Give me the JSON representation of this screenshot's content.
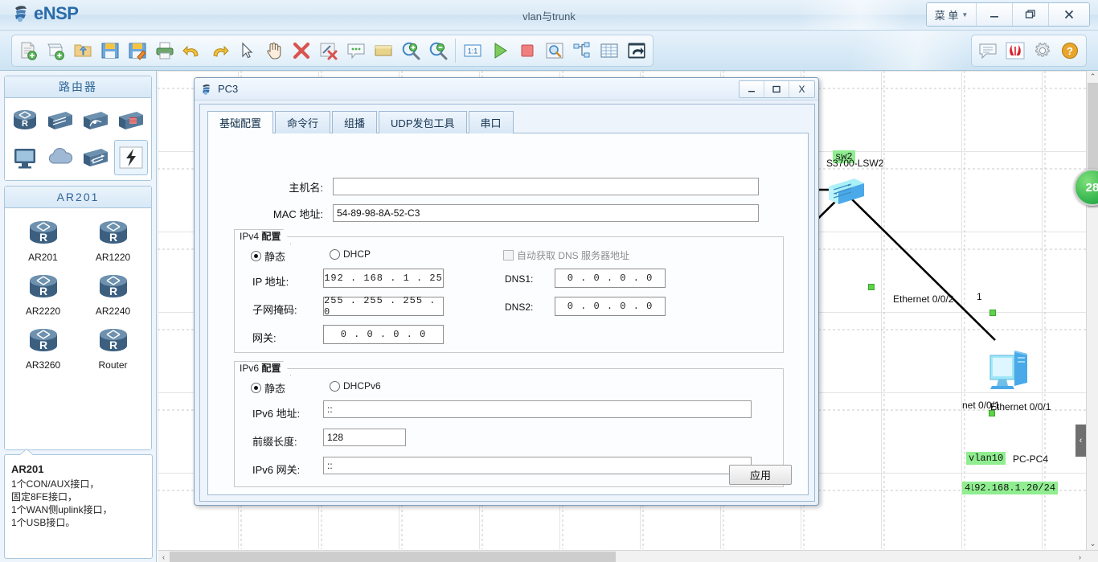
{
  "titlebar": {
    "app_name": "eNSP",
    "project_title": "vlan与trunk",
    "menu_label": "菜 单",
    "minimize": "—",
    "restore": "❐",
    "close": "✕"
  },
  "toolbar": {
    "buttons": [
      {
        "name": "new-topology-icon",
        "tip": "新建"
      },
      {
        "name": "new-device-icon",
        "tip": "新建设备"
      },
      {
        "name": "open-folder-icon",
        "tip": "打开"
      },
      {
        "name": "save-icon",
        "tip": "保存"
      },
      {
        "name": "save-as-icon",
        "tip": "另存为"
      },
      {
        "name": "print-icon",
        "tip": "打印"
      },
      {
        "name": "undo-icon",
        "tip": "撤销"
      },
      {
        "name": "redo-icon",
        "tip": "重做"
      },
      {
        "name": "select-pointer-icon",
        "tip": "选择"
      },
      {
        "name": "pan-hand-icon",
        "tip": "移动"
      },
      {
        "name": "delete-icon",
        "tip": "删除"
      },
      {
        "name": "remove-link-icon",
        "tip": "删除连线"
      },
      {
        "name": "comment-icon",
        "tip": "注释"
      },
      {
        "name": "rectangle-icon",
        "tip": "矩形"
      },
      {
        "name": "zoom-in-icon",
        "tip": "放大"
      },
      {
        "name": "zoom-out-icon",
        "tip": "缩小"
      }
    ],
    "buttons2": [
      {
        "name": "zoom-reset-1to1-icon",
        "tip": "1:1"
      },
      {
        "name": "start-device-icon",
        "tip": "开启设备"
      },
      {
        "name": "stop-device-icon",
        "tip": "停止设备"
      },
      {
        "name": "capture-packet-icon",
        "tip": "数据抓包"
      },
      {
        "name": "topology-tree-icon",
        "tip": "拓扑树"
      },
      {
        "name": "grid-icon",
        "tip": "网格"
      },
      {
        "name": "restore-window-icon",
        "tip": "还原窗口"
      }
    ],
    "right_buttons": [
      {
        "name": "feedback-icon",
        "tip": "反馈"
      },
      {
        "name": "huawei-logo-icon",
        "tip": "华为"
      },
      {
        "name": "settings-gear-icon",
        "tip": "设置"
      },
      {
        "name": "help-icon",
        "tip": "帮助"
      }
    ]
  },
  "sidebar": {
    "category_header": "路由器",
    "device_types": [
      {
        "name": "router-type-icon",
        "selected": false
      },
      {
        "name": "switch-type-icon",
        "selected": false
      },
      {
        "name": "wlan-type-icon",
        "selected": false
      },
      {
        "name": "firewall-type-icon",
        "selected": false
      },
      {
        "name": "endpoint-type-icon",
        "selected": false
      },
      {
        "name": "cloud-type-icon",
        "selected": false
      },
      {
        "name": "other-device-type-icon",
        "selected": false
      },
      {
        "name": "connection-type-icon",
        "selected": true
      }
    ],
    "model_header": "AR201",
    "models": [
      {
        "label": "AR201"
      },
      {
        "label": "AR1220"
      },
      {
        "label": "AR2220"
      },
      {
        "label": "AR2240"
      },
      {
        "label": "AR3260"
      },
      {
        "label": "Router"
      }
    ],
    "info": {
      "title": "AR201",
      "body": "1个CON/AUX接口，\n固定8FE接口，\n1个WAN侧uplink接口，\n1个USB接口。"
    }
  },
  "canvas": {
    "nodes": [
      {
        "name": "switch-sw2",
        "label": "S3700-LSW2",
        "tag": "sw2"
      },
      {
        "name": "pc-pc4",
        "label": "PC-PC4",
        "tag": "vlan10",
        "ip_tag": "192.168.1.20/24"
      }
    ],
    "interface_labels": [
      "Ethernet 0/0/2",
      "Ethernet 0/0/1",
      "net 0/0/1",
      "1",
      "4"
    ],
    "badge_count": "28",
    "collapse_arrow": "‹",
    "scroll_up": "⌃",
    "scroll_down": "⌄",
    "scroll_left": "‹",
    "scroll_right": "›"
  },
  "pc3_dialog": {
    "title": "PC3",
    "window_buttons": {
      "minimize": "—",
      "maximize": "❐",
      "close": "X"
    },
    "tabs": [
      {
        "label": "基础配置",
        "active": true
      },
      {
        "label": "命令行",
        "active": false
      },
      {
        "label": "组播",
        "active": false
      },
      {
        "label": "UDP发包工具",
        "active": false
      },
      {
        "label": "串口",
        "active": false
      }
    ],
    "hostname": {
      "label": "主机名:",
      "value": "",
      "placeholder": ""
    },
    "mac": {
      "label": "MAC 地址:",
      "value": "54-89-98-8A-52-C3"
    },
    "ipv4": {
      "group_title_prefix": "IPv4 ",
      "group_title_bold": "配置",
      "static_label": "静态",
      "static_selected": true,
      "dhcp_label": "DHCP",
      "dhcp_selected": false,
      "auto_dns_label": "自动获取 DNS 服务器地址",
      "auto_dns_checked": false,
      "ip_label": "IP 地址:",
      "ip_value": "192 . 168 .  1  . 25",
      "mask_label": "子网掩码:",
      "mask_value": "255 . 255 . 255 .  0",
      "gateway_label": "网关:",
      "gateway_value": "0  .  0  .  0  .  0",
      "dns1_label": "DNS1:",
      "dns1_value": "0  .  0  .  0  .  0",
      "dns2_label": "DNS2:",
      "dns2_value": "0  .  0  .  0  .  0"
    },
    "ipv6": {
      "group_title_prefix": "IPv6 ",
      "group_title_bold": "配置",
      "static_label": "静态",
      "static_selected": true,
      "dhcpv6_label": "DHCPv6",
      "dhcpv6_selected": false,
      "addr_label": "IPv6 地址:",
      "addr_value": "::",
      "prefix_label": "前缀长度:",
      "prefix_value": "128",
      "gateway_label": "IPv6 网关:",
      "gateway_value": "::"
    },
    "apply_label": "应用"
  }
}
